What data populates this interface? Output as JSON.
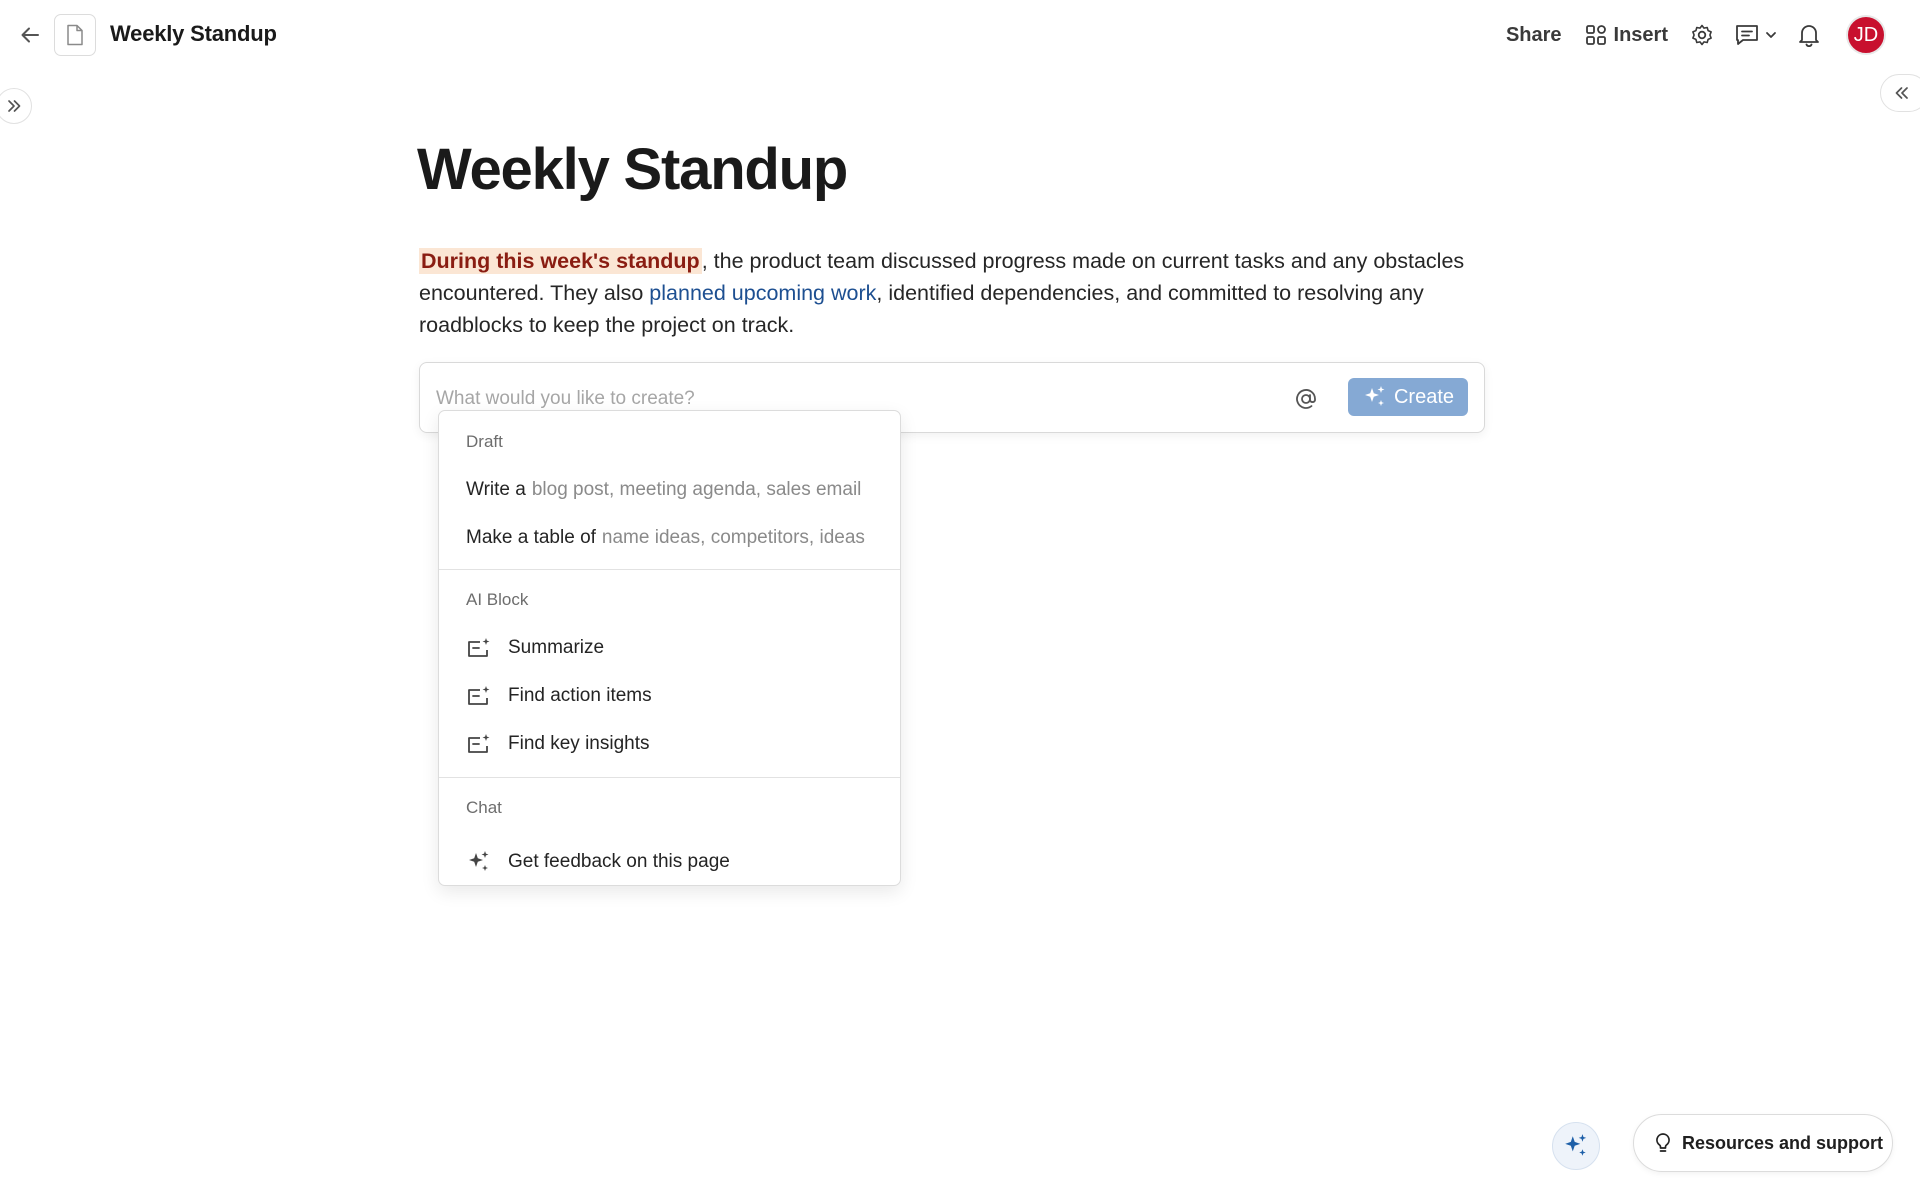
{
  "header": {
    "doc_title": "Weekly Standup",
    "share_label": "Share",
    "insert_label": "Insert",
    "avatar_initials": "JD",
    "avatar_color": "#c8102e"
  },
  "document": {
    "heading": "Weekly Standup",
    "highlight_text": "During this week's standup",
    "text_1": ", the product team discussed progress made on current tasks and any obstacles encountered. They also ",
    "link_text": "planned upcoming work",
    "text_2": ", identified dependencies, and committed to resolving any roadblocks to keep the project on track."
  },
  "prompt": {
    "placeholder": "What would you like to create?",
    "value": "",
    "create_label": "Create",
    "create_color": "#85a9d4"
  },
  "menu": {
    "draft": {
      "heading": "Draft",
      "items": [
        {
          "prefix": "Write a",
          "hint": "blog post, meeting agenda, sales email"
        },
        {
          "prefix": "Make a table of",
          "hint": "name ideas, competitors, ideas"
        }
      ]
    },
    "ai_block": {
      "heading": "AI Block",
      "items": [
        {
          "label": "Summarize",
          "icon": "ai-block-icon"
        },
        {
          "label": "Find action items",
          "icon": "ai-block-icon"
        },
        {
          "label": "Find key insights",
          "icon": "ai-block-icon"
        }
      ]
    },
    "chat": {
      "heading": "Chat",
      "items": [
        {
          "label": "Get feedback on this page",
          "icon": "sparkle-icon"
        }
      ]
    }
  },
  "footer": {
    "resources_label": "Resources and support"
  }
}
